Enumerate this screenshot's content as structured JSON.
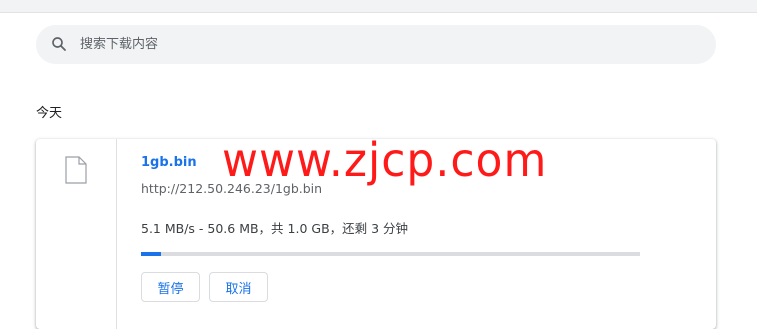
{
  "search": {
    "placeholder": "搜索下载内容",
    "icon": "search-icon"
  },
  "section": {
    "date_label": "今天"
  },
  "download": {
    "file_icon": "file-icon",
    "file_name": "1gb.bin",
    "url": "http://212.50.246.23/1gb.bin",
    "status": "5.1 MB/s - 50.6 MB，共 1.0 GB，还剩 3 分钟",
    "progress_percent": 4,
    "pause_label": "暂停",
    "cancel_label": "取消"
  },
  "watermark": {
    "text": "www.zjcp.com"
  },
  "colors": {
    "accent": "#1a73e8",
    "watermark": "#ff1a1a",
    "search_bg": "#f1f3f4",
    "track": "#dadce0"
  }
}
